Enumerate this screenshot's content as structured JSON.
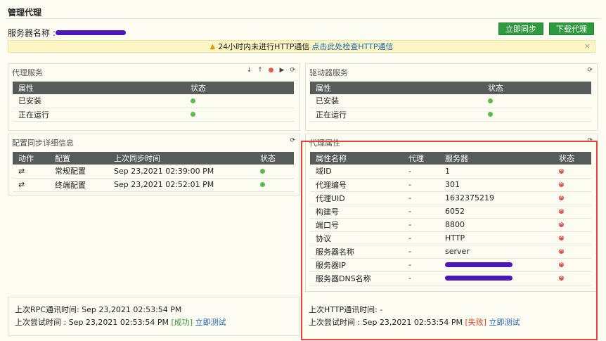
{
  "header": {
    "title": "管理代理",
    "server_label": "服务器名称 :",
    "sync_button": "立即同步",
    "download_button": "下载代理"
  },
  "banner": {
    "text": "24小时内未进行HTTP通信",
    "link": "点击此处检查HTTP通信",
    "close": "×"
  },
  "proxy_service": {
    "title": "代理服务",
    "headers": [
      "属性",
      "状态"
    ],
    "rows": [
      {
        "name": "已安装",
        "status": "ok"
      },
      {
        "name": "正在运行",
        "status": "ok"
      }
    ]
  },
  "driver_service": {
    "title": "驱动器服务",
    "headers": [
      "属性",
      "状态"
    ],
    "rows": [
      {
        "name": "已安装",
        "status": "ok"
      },
      {
        "name": "正在运行",
        "status": "ok"
      }
    ]
  },
  "config_sync": {
    "title": "配置同步详细信息",
    "headers": [
      "动作",
      "配置",
      "上次同步时间",
      "状态"
    ],
    "rows": [
      {
        "action": "⇄",
        "config": "常规配置",
        "time": "Sep 23,2021 02:39:00 PM",
        "status": "ok"
      },
      {
        "action": "⇄",
        "config": "终端配置",
        "time": "Sep 23,2021 02:52:01 PM",
        "status": "ok"
      }
    ]
  },
  "proxy_props": {
    "title": "代理属性",
    "headers": [
      "属性名称",
      "代理",
      "服务器",
      "状态"
    ],
    "rows": [
      {
        "name": "域ID",
        "proxy": "-",
        "server": "1",
        "status": "fail"
      },
      {
        "name": "代理编号",
        "proxy": "-",
        "server": "301",
        "status": "fail"
      },
      {
        "name": "代理UID",
        "proxy": "-",
        "server": "1632375219",
        "status": "fail"
      },
      {
        "name": "构建号",
        "proxy": "-",
        "server": "6052",
        "status": "fail"
      },
      {
        "name": "端口号",
        "proxy": "-",
        "server": "8800",
        "status": "fail"
      },
      {
        "name": "协议",
        "proxy": "-",
        "server": "HTTP",
        "status": "fail"
      },
      {
        "name": "服务器名称",
        "proxy": "-",
        "server": "server",
        "status": "fail"
      },
      {
        "name": "服务器IP",
        "proxy": "-",
        "server": "",
        "status": "fail"
      },
      {
        "name": "服务器DNS名称",
        "proxy": "-",
        "server": "",
        "status": "fail"
      }
    ]
  },
  "footer_left": {
    "rpc_label": "上次RPC通讯时间:",
    "rpc_time": "Sep 23,2021 02:53:54 PM",
    "try_label": "上次尝试时间 :",
    "try_time": "Sep 23,2021 02:53:54 PM",
    "result": "[成功]",
    "test_link": "立即测试"
  },
  "footer_right": {
    "http_label": "上次HTTP通讯时间:",
    "http_time": "-",
    "try_label": "上次尝试时间 :",
    "try_time": "Sep 23,2021 02:53:54 PM",
    "result": "[失败]",
    "test_link": "立即测试"
  },
  "colors": {
    "accent_green": "#2f9a3e",
    "fail_red": "#e0504a",
    "ok_green": "#5dbb49",
    "highlight": "#e7423c"
  }
}
